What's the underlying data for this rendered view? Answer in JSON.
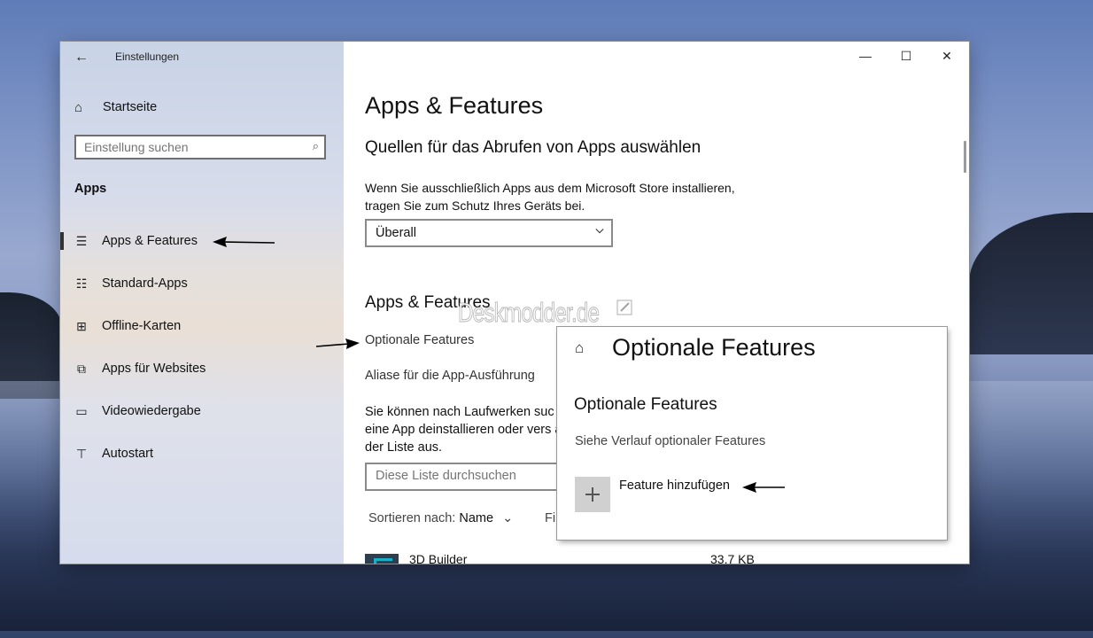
{
  "window": {
    "title": "Einstellungen",
    "controls": {
      "minimize": "—",
      "maximize": "☐",
      "close": "✕"
    }
  },
  "sidebar": {
    "home_label": "Startseite",
    "search_placeholder": "Einstellung suchen",
    "section_label": "Apps",
    "items": [
      {
        "label": "Apps & Features",
        "icon": "list-icon",
        "active": true
      },
      {
        "label": "Standard-Apps",
        "icon": "default-apps-icon",
        "active": false
      },
      {
        "label": "Offline-Karten",
        "icon": "map-icon",
        "active": false
      },
      {
        "label": "Apps für Websites",
        "icon": "website-apps-icon",
        "active": false
      },
      {
        "label": "Videowiedergabe",
        "icon": "video-icon",
        "active": false
      },
      {
        "label": "Autostart",
        "icon": "autostart-icon",
        "active": false
      }
    ]
  },
  "main": {
    "title": "Apps & Features",
    "sources_heading": "Quellen für das Abrufen von Apps auswählen",
    "sources_desc": "Wenn Sie ausschließlich Apps aus dem Microsoft Store installieren, tragen Sie zum Schutz Ihres Geräts bei.",
    "sources_value": "Überall",
    "apps_heading": "Apps & Features",
    "optional_features_link": "Optionale Features",
    "aliases_link": "Aliase für die App-Ausführung",
    "drives_text": "Sie können nach Laufwerken suc eine App deinstallieren oder vers aus der Liste aus.",
    "list_search_placeholder": "Diese Liste durchsuchen",
    "sort_label": "Sortieren nach:",
    "sort_value": "Name",
    "filter_fragment": "Fi",
    "apps": [
      {
        "name": "3D Builder",
        "size": "33,7 KB"
      }
    ]
  },
  "watermark": "Deskmodder.de",
  "popup": {
    "title": "Optionale Features",
    "heading": "Optionale Features",
    "history_link": "Siehe Verlauf optionaler Features",
    "add_label": "Feature hinzufügen"
  },
  "colors": {
    "accent_dark": "#333333",
    "sidebar_top": "#c8d3e6",
    "add_button_bg": "#d0d0d0"
  }
}
